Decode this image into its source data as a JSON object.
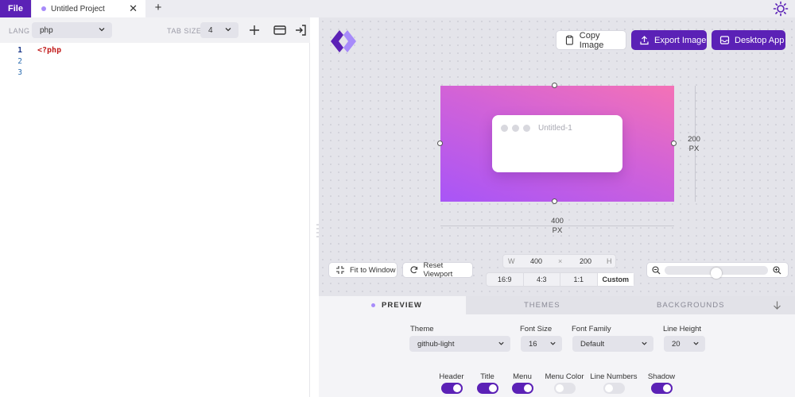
{
  "topbar": {
    "file_label": "File",
    "tab_title": "Untitled Project",
    "close_glyph": "✕",
    "newtab_glyph": "+",
    "theme_icon": "sun-icon"
  },
  "editor": {
    "lang_label": "LANG",
    "lang_value": "php",
    "tabsize_label": "TAB SIZE",
    "tabsize_value": "4",
    "icons": [
      "plus-icon",
      "card-icon",
      "login-icon"
    ],
    "line_numbers": [
      "1",
      "2",
      "3"
    ],
    "code_line": "<?php"
  },
  "preview": {
    "buttons": {
      "copy": "Copy Image",
      "export": "Export Image",
      "desktop": "Desktop App"
    },
    "window_title": "Untitled-1",
    "height_value": "200",
    "height_unit": "PX",
    "width_value": "400",
    "width_unit": "PX",
    "fit_label": "Fit to Window",
    "reset_label": "Reset Viewport",
    "w_label": "W",
    "w_value": "400",
    "times_glyph": "×",
    "h_value": "200",
    "h_label": "H",
    "ratios": [
      "16:9",
      "4:3",
      "1:1",
      "Custom"
    ],
    "zoom_level": 0.5,
    "gradient_colors": [
      "#a855f7",
      "#f472b6"
    ]
  },
  "settings": {
    "tabs": [
      "PREVIEW",
      "THEMES",
      "BACKGROUNDS"
    ],
    "theme_label": "Theme",
    "theme_value": "github-light",
    "fontsize_label": "Font Size",
    "fontsize_value": "16",
    "fontfamily_label": "Font Family",
    "fontfamily_value": "Default",
    "lineheight_label": "Line Height",
    "lineheight_value": "20",
    "toggles": [
      {
        "label": "Header",
        "on": true
      },
      {
        "label": "Title",
        "on": true
      },
      {
        "label": "Menu",
        "on": true
      },
      {
        "label": "Menu Color",
        "on": false
      },
      {
        "label": "Line Numbers",
        "on": false
      },
      {
        "label": "Shadow",
        "on": true
      }
    ]
  },
  "colors": {
    "accent": "#5b21b6",
    "accent_light": "#a78bfa"
  }
}
